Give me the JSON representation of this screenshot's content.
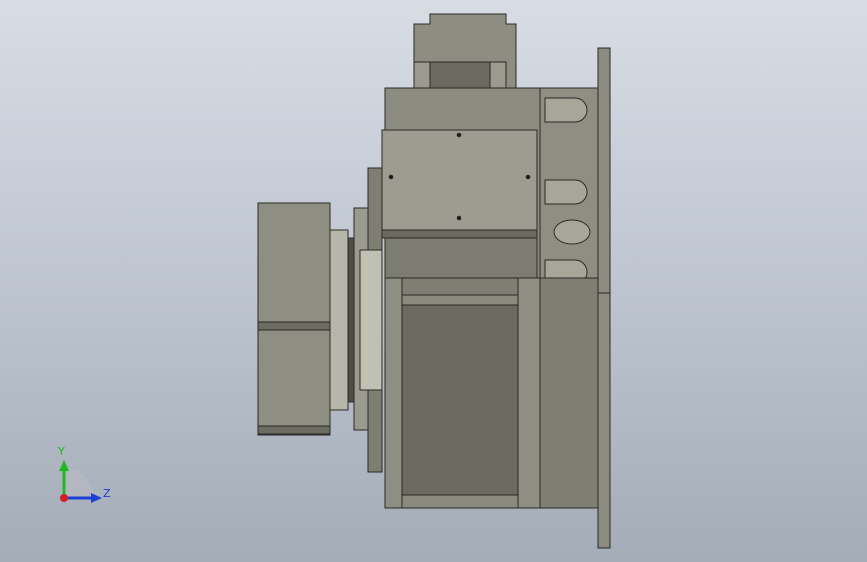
{
  "viewport": {
    "background_top": "#d8dde4",
    "background_bottom": "#a4acb8"
  },
  "model": {
    "body_color": "#8a8a7e",
    "body_light": "#a4a497",
    "body_dark": "#5f5f55",
    "edge_color": "#2a2a26"
  },
  "triad": {
    "y_label": "Y",
    "z_label": "Z",
    "y_color": "#1fb91f",
    "z_color": "#1f3fd6",
    "x_color": "#d41f1f"
  }
}
